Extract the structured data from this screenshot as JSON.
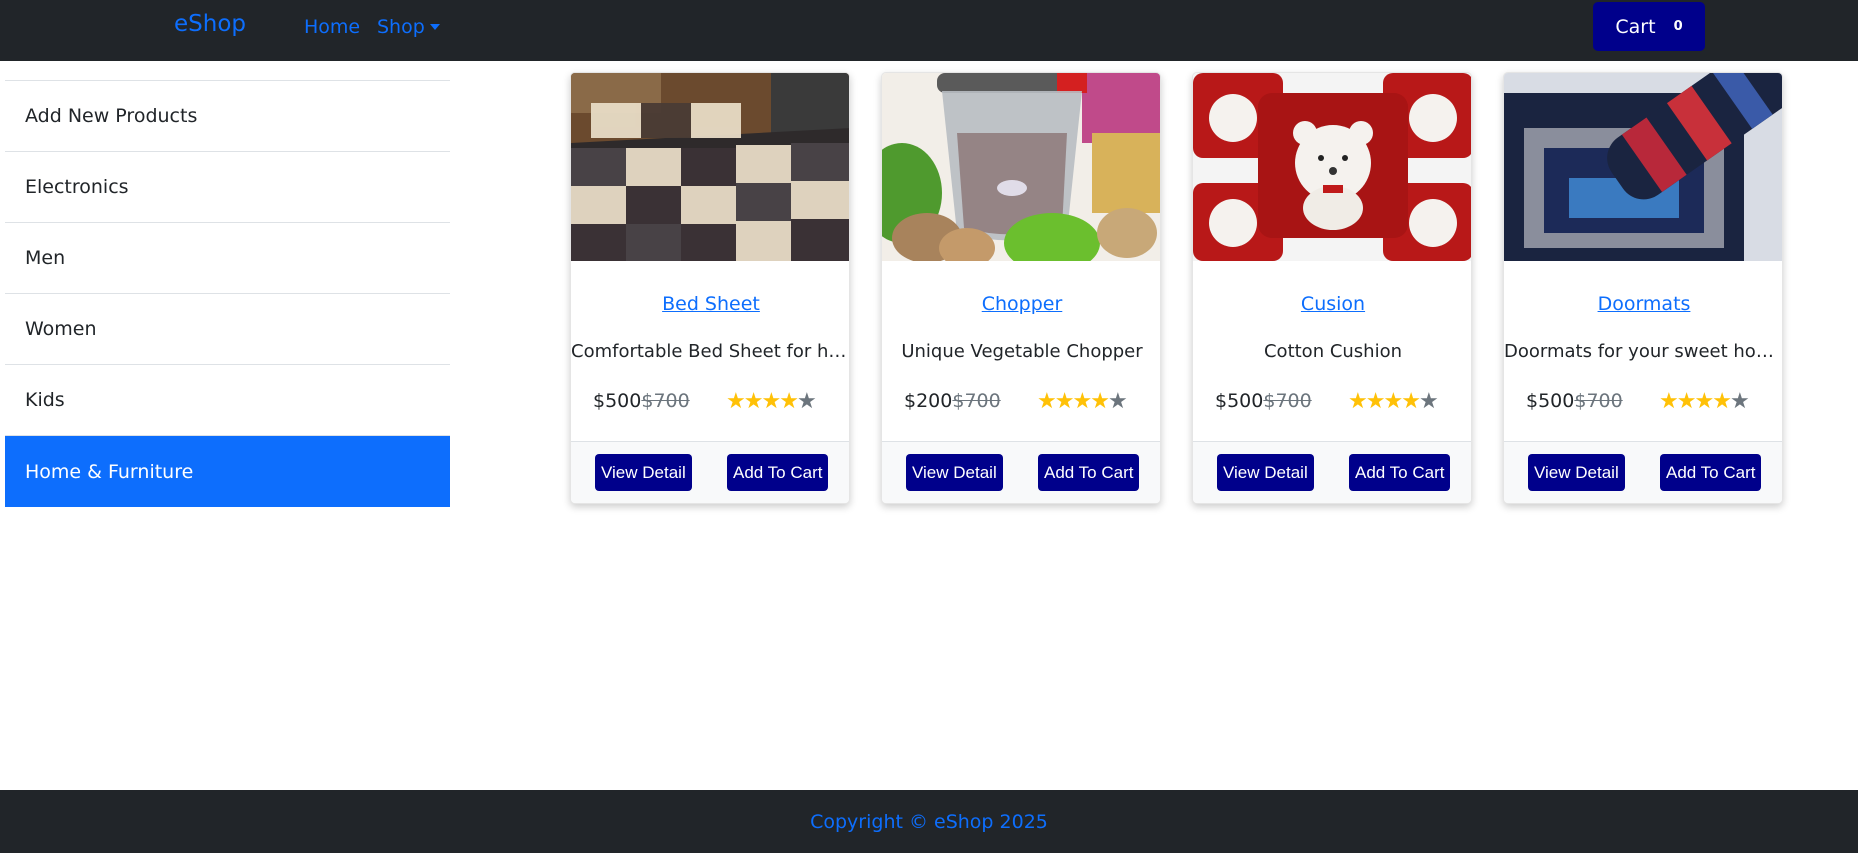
{
  "nav": {
    "brand": "eShop",
    "home": "Home",
    "shop": "Shop",
    "cart_label": "Cart",
    "cart_count": "0"
  },
  "sidebar": {
    "items": [
      {
        "label": "Add New Products"
      },
      {
        "label": "Electronics"
      },
      {
        "label": "Men"
      },
      {
        "label": "Women"
      },
      {
        "label": "Kids"
      },
      {
        "label": "Home & Furniture"
      }
    ],
    "active_index": 5
  },
  "products": [
    {
      "title": "Bed Sheet",
      "description": "Comfortable Bed Sheet for home",
      "price": "$500",
      "old_price": "$700",
      "rating": 4,
      "view_label": "View Detail",
      "add_label": "Add To Cart"
    },
    {
      "title": "Chopper",
      "description": "Unique Vegetable Chopper",
      "price": "$200",
      "old_price": "$700",
      "rating": 4,
      "view_label": "View Detail",
      "add_label": "Add To Cart"
    },
    {
      "title": "Cusion",
      "description": "Cotton Cushion",
      "price": "$500",
      "old_price": "$700",
      "rating": 4,
      "view_label": "View Detail",
      "add_label": "Add To Cart"
    },
    {
      "title": "Doormats",
      "description": "Doormats for your sweet home",
      "price": "$500",
      "old_price": "$700",
      "rating": 4,
      "view_label": "View Detail",
      "add_label": "Add To Cart"
    }
  ],
  "footer": {
    "text": "Copyright © eShop 2025"
  },
  "colors": {
    "navbar": "#212529",
    "link": "#0d6efd",
    "button": "#00008b",
    "star": "#ffc107"
  }
}
